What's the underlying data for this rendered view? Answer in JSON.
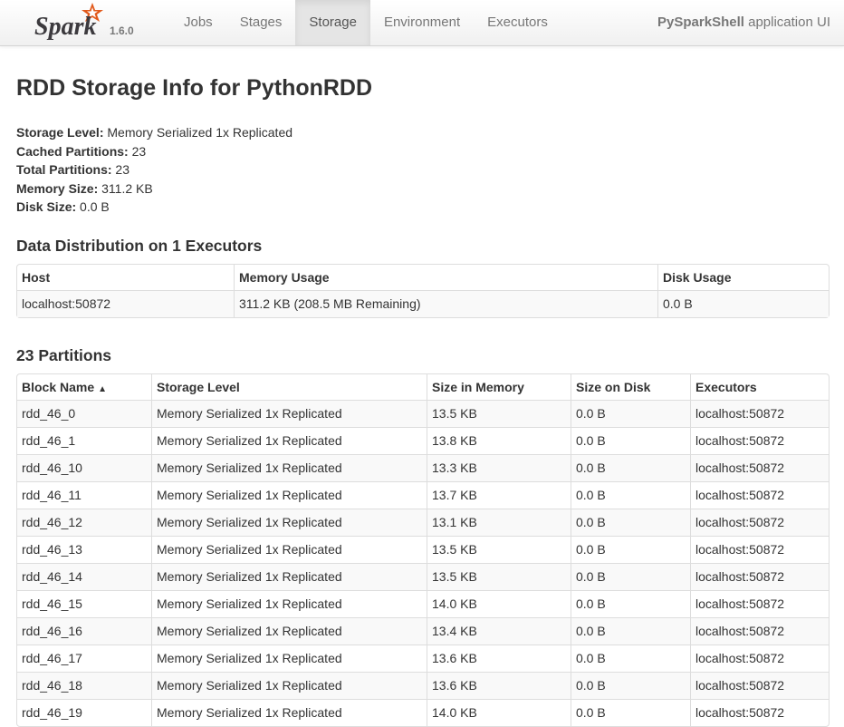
{
  "brand": {
    "version": "1.6.0",
    "logo_color": "#e25a1c"
  },
  "nav": {
    "items": [
      "Jobs",
      "Stages",
      "Storage",
      "Environment",
      "Executors"
    ],
    "active": "Storage"
  },
  "app": {
    "name": "PySparkShell",
    "suffix": " application UI"
  },
  "page": {
    "title": "RDD Storage Info for PythonRDD",
    "summary": [
      {
        "label": "Storage Level:",
        "value": " Memory Serialized 1x Replicated"
      },
      {
        "label": "Cached Partitions:",
        "value": " 23"
      },
      {
        "label": "Total Partitions:",
        "value": " 23"
      },
      {
        "label": "Memory Size:",
        "value": " 311.2 KB"
      },
      {
        "label": "Disk Size:",
        "value": " 0.0 B"
      }
    ]
  },
  "distribution": {
    "heading": "Data Distribution on 1 Executors",
    "columns": [
      "Host",
      "Memory Usage",
      "Disk Usage"
    ],
    "rows": [
      [
        "localhost:50872",
        "311.2 KB (208.5 MB Remaining)",
        "0.0 B"
      ]
    ]
  },
  "partitions": {
    "heading": "23 Partitions",
    "columns": [
      "Block Name",
      "Storage Level",
      "Size in Memory",
      "Size on Disk",
      "Executors"
    ],
    "sort_indicator": "▲",
    "rows": [
      [
        "rdd_46_0",
        "Memory Serialized 1x Replicated",
        "13.5 KB",
        "0.0 B",
        "localhost:50872"
      ],
      [
        "rdd_46_1",
        "Memory Serialized 1x Replicated",
        "13.8 KB",
        "0.0 B",
        "localhost:50872"
      ],
      [
        "rdd_46_10",
        "Memory Serialized 1x Replicated",
        "13.3 KB",
        "0.0 B",
        "localhost:50872"
      ],
      [
        "rdd_46_11",
        "Memory Serialized 1x Replicated",
        "13.7 KB",
        "0.0 B",
        "localhost:50872"
      ],
      [
        "rdd_46_12",
        "Memory Serialized 1x Replicated",
        "13.1 KB",
        "0.0 B",
        "localhost:50872"
      ],
      [
        "rdd_46_13",
        "Memory Serialized 1x Replicated",
        "13.5 KB",
        "0.0 B",
        "localhost:50872"
      ],
      [
        "rdd_46_14",
        "Memory Serialized 1x Replicated",
        "13.5 KB",
        "0.0 B",
        "localhost:50872"
      ],
      [
        "rdd_46_15",
        "Memory Serialized 1x Replicated",
        "14.0 KB",
        "0.0 B",
        "localhost:50872"
      ],
      [
        "rdd_46_16",
        "Memory Serialized 1x Replicated",
        "13.4 KB",
        "0.0 B",
        "localhost:50872"
      ],
      [
        "rdd_46_17",
        "Memory Serialized 1x Replicated",
        "13.6 KB",
        "0.0 B",
        "localhost:50872"
      ],
      [
        "rdd_46_18",
        "Memory Serialized 1x Replicated",
        "13.6 KB",
        "0.0 B",
        "localhost:50872"
      ],
      [
        "rdd_46_19",
        "Memory Serialized 1x Replicated",
        "14.0 KB",
        "0.0 B",
        "localhost:50872"
      ]
    ]
  }
}
